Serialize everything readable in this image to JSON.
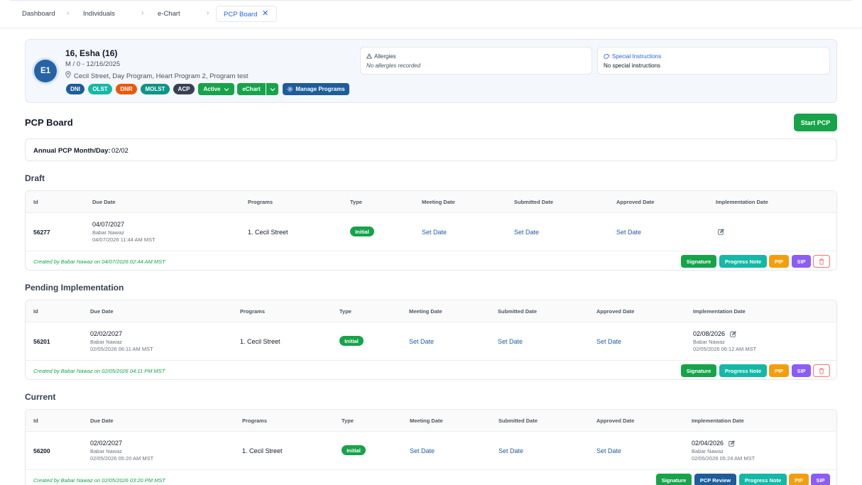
{
  "breadcrumb": {
    "items": [
      "Dashboard",
      "Individuals",
      "e-Chart"
    ],
    "active": "PCP Board",
    "close": "✕"
  },
  "patient": {
    "initials": "E1",
    "name": "16, Esha (16)",
    "meta": "M / 0 - 12/16/2025",
    "location": "Cecil Street, Day Program, Heart Program 2, Program test",
    "badges": [
      {
        "label": "DNI",
        "color": "#1e5c9a"
      },
      {
        "label": "OLST",
        "color": "#14b8a6"
      },
      {
        "label": "DNR",
        "color": "#ea580c"
      },
      {
        "label": "MOLST",
        "color": "#0d9488"
      },
      {
        "label": "ACP",
        "color": "#374151"
      }
    ],
    "status_button": "Active",
    "echart_button": "eChart",
    "manage_button": "Manage Programs",
    "allergies": {
      "title": "Allergies",
      "value": "No allergies recorded"
    },
    "special": {
      "title": "Special Instructions",
      "value": "No special instructions"
    }
  },
  "page": {
    "title": "PCP Board",
    "start_button": "Start PCP",
    "annual_label": "Annual PCP Month/Day:",
    "annual_value": "02/02"
  },
  "columns": [
    "Id",
    "Due Date",
    "Programs",
    "Type",
    "Meeting Date",
    "Submitted Date",
    "Approved Date",
    "Implementation Date"
  ],
  "actions": {
    "signature": "Signature",
    "progress_note": "Progress Note",
    "pip": "PIP",
    "sip": "SIP",
    "pcp_review": "PCP Review"
  },
  "sections": [
    {
      "title": "Draft",
      "row": {
        "id": "56277",
        "due_date": "04/07/2027",
        "due_by": "Babar Nawaz",
        "due_ts": "04/07/2026 11:44 AM MST",
        "program": "1. Cecil Street",
        "type": "Initial",
        "meeting": "Set Date",
        "submitted": "Set Date",
        "approved": "Set Date",
        "impl_date": "",
        "impl_by": "",
        "impl_ts": ""
      },
      "created": "Created by Babar Nawaz on 04/07/2026 02:44 AM MST"
    },
    {
      "title": "Pending Implementation",
      "row": {
        "id": "56201",
        "due_date": "02/02/2027",
        "due_by": "Babar Nawaz",
        "due_ts": "02/05/2026 06:11 AM MST",
        "program": "1. Cecil Street",
        "type": "Initial",
        "meeting": "Set Date",
        "submitted": "Set Date",
        "approved": "Set Date",
        "impl_date": "02/08/2026",
        "impl_by": "Babar Nawaz",
        "impl_ts": "02/05/2026 06:12 AM MST"
      },
      "created": "Created by Babar Nawaz on 02/05/2026 04:11 PM MST"
    },
    {
      "title": "Current",
      "row": {
        "id": "56200",
        "due_date": "02/02/2027",
        "due_by": "Babar Nawaz",
        "due_ts": "02/05/2026 05:20 AM MST",
        "program": "1. Cecil Street",
        "type": "Initial",
        "meeting": "Set Date",
        "submitted": "Set Date",
        "approved": "Set Date",
        "impl_date": "02/04/2026",
        "impl_by": "Babar Nawaz",
        "impl_ts": "02/05/2026 05:24 AM MST"
      },
      "created": "Created by Babar Nawaz on 02/05/2026 03:20 PM MST"
    }
  ],
  "colors": {
    "primary_green": "#16a34a",
    "teal": "#14b8a6",
    "pip": "#f59e0b",
    "sip": "#8b5cf6",
    "pcp_review": "#1e5c9a",
    "link": "#1e5aa8"
  }
}
